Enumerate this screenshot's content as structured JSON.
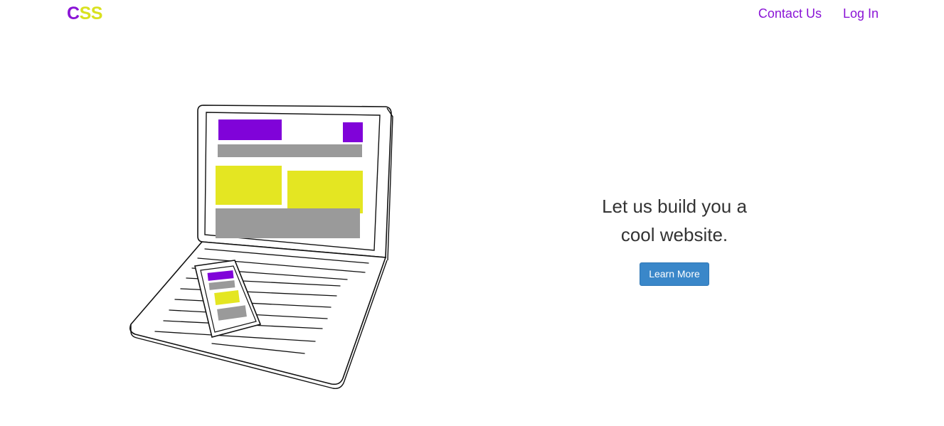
{
  "header": {
    "logo": {
      "c": "C",
      "ss": "SS"
    },
    "nav": [
      {
        "label": "Contact Us"
      },
      {
        "label": "Log In"
      }
    ]
  },
  "hero": {
    "title": "Let us build you a cool website.",
    "button_label": "Learn More"
  },
  "colors": {
    "brand_purple": "#8a14d6",
    "brand_yellow": "#d9e11f",
    "button_blue": "#3a87c9",
    "placeholder_gray": "#9a9a9a"
  },
  "icons": {
    "illustration": "laptop-with-phone-illustration"
  }
}
